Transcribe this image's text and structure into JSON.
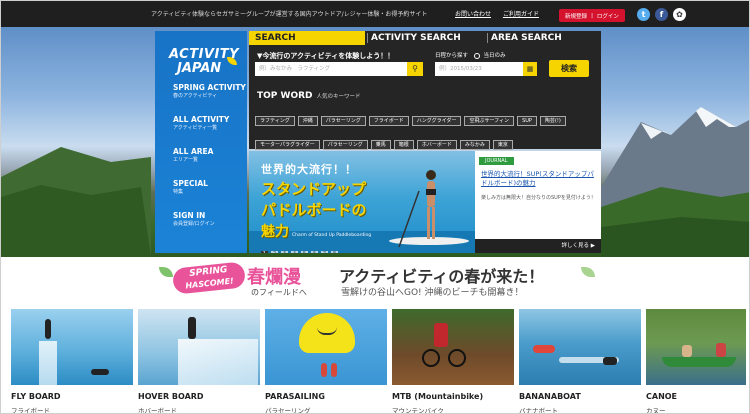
{
  "topbar": {
    "tagline": "アクティビティ体験ならセガサミーグループが運営する国内アウトドア/レジャー体験・お得予約サイト",
    "links": [
      "お問い合わせ",
      "ご利用ガイド"
    ],
    "register_label": "新規登録",
    "login_label": "ログイン",
    "social": [
      "twitter-icon",
      "facebook-icon",
      "pinterest-icon"
    ]
  },
  "nav": {
    "logo_line1": "ACTIVITY",
    "logo_line2": "JAPAN",
    "items": [
      {
        "label": "SPRING ACTIVITY",
        "sub": "春のアクティビティ"
      },
      {
        "label": "ALL ACTIVITY",
        "sub": "アクティビティ一覧"
      },
      {
        "label": "ALL AREA",
        "sub": "エリア一覧"
      },
      {
        "label": "SPECIAL",
        "sub": "特集"
      },
      {
        "label": "SIGN IN",
        "sub": "会員登録/ログイン"
      }
    ]
  },
  "search": {
    "tabs": [
      "SEARCH",
      "ACTIVITY SEARCH",
      "AREA SEARCH"
    ],
    "prompt": "▼今流行のアクティビティを体験しよう！！",
    "keyword_placeholder": "例）みなかみ　ラフティング",
    "date_label": "日程から探す",
    "today_only": "当日のみ",
    "date_placeholder": "例）2015/03/23",
    "search_button": "検索",
    "topword_title": "TOP WORD",
    "topword_sub": "人気のキーワード",
    "chips": [
      "ラフティング",
      "沖縄",
      "パラセーリング",
      "フライボード",
      "ハンググライダー",
      "空飛ぶサーフィン",
      "SUP",
      "陶芸(!)",
      "モーターパラグライダー",
      "パラセーリング",
      "乗馬",
      "箱根",
      "ホバーボード",
      "みなかみ",
      "東京"
    ]
  },
  "banner": {
    "line1": "世界的大流行！！",
    "line2": "スタンドアップ",
    "line3": "パドルボードの",
    "line4": "魅力",
    "caption": "Charm of Stand Up Paddleboarding",
    "dots": [
      "1",
      "2",
      "3",
      "4",
      "5",
      "6",
      "7",
      "8"
    ]
  },
  "article": {
    "badge": "JOURNAL",
    "title": "世界的大流行！SUP(スタンドアップパドルボード)の魅力",
    "desc": "楽しみ方は無限大！自分なりのSUPを見付けよう！",
    "more": "詳しく見る ▶"
  },
  "campaign": {
    "badge_line1": "SPRING",
    "badge_line2": "HASCOME!",
    "kanji": "春爛漫",
    "field": "のフィールドへ",
    "headline": "アクティビティの春が来た！",
    "subhead": "雪解けの谷山へGO! 沖縄のビーチも開幕き！"
  },
  "activities": [
    {
      "en": "FLY BOARD",
      "ja": "フライボード"
    },
    {
      "en": "HOVER BOARD",
      "ja": "ホバーボード"
    },
    {
      "en": "PARASAILING",
      "ja": "パラセーリング"
    },
    {
      "en": "MTB (Mountainbike)",
      "ja": "マウンテンバイク"
    },
    {
      "en": "BANANABOAT",
      "ja": "バナナボート"
    },
    {
      "en": "CANOE",
      "ja": "カヌー"
    }
  ],
  "colors": {
    "accent_yellow": "#f5d400",
    "nav_blue": "#1873c6",
    "spring_pink": "#e8539a",
    "journal_green": "#2e9b3e"
  }
}
